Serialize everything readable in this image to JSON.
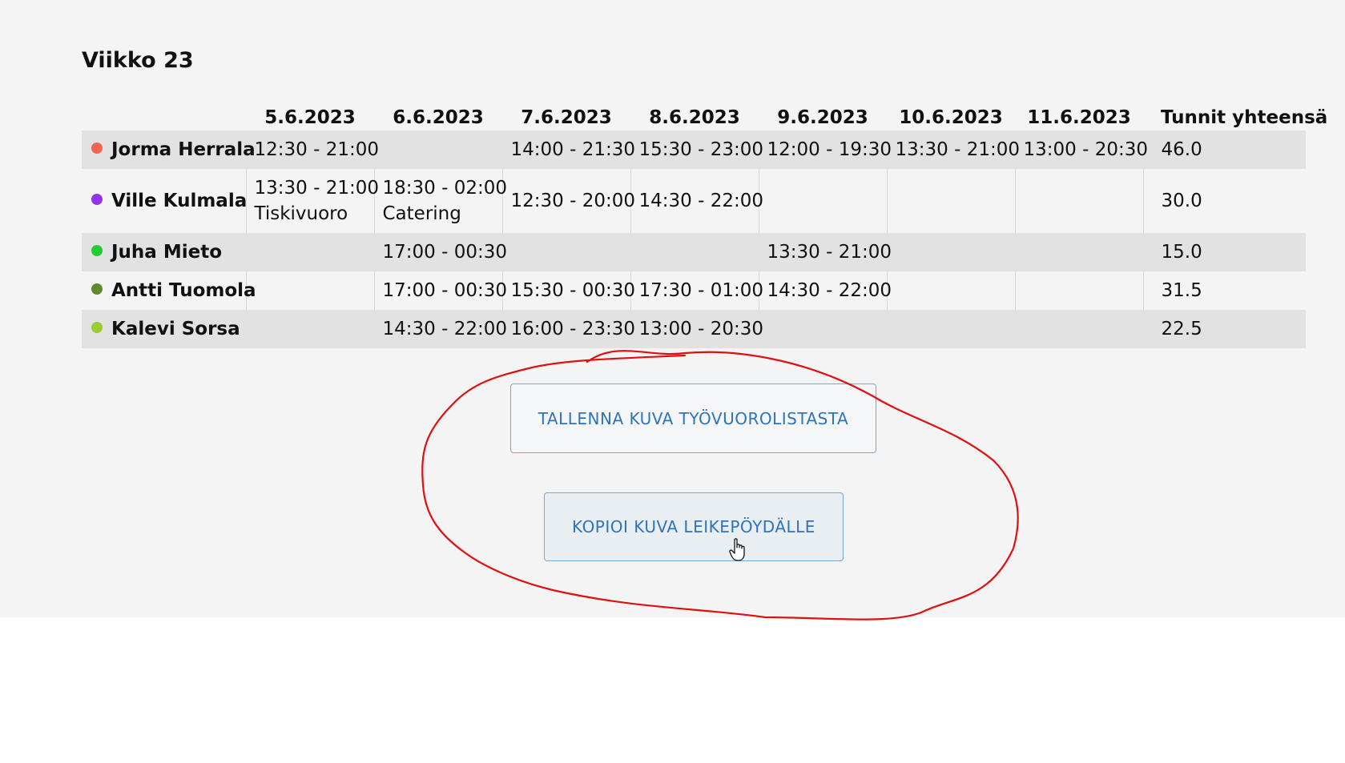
{
  "week": {
    "title": "Viikko 23"
  },
  "table": {
    "headers": [
      "",
      "5.6.2023",
      "6.6.2023",
      "7.6.2023",
      "8.6.2023",
      "9.6.2023",
      "10.6.2023",
      "11.6.2023",
      "Tunnit yhteensä"
    ],
    "rows": [
      {
        "name": "Jorma Herrala",
        "color": "#f0654f",
        "shifts": [
          {
            "time": "12:30 - 21:00",
            "note": ""
          },
          {
            "time": "",
            "note": ""
          },
          {
            "time": "14:00 - 21:30",
            "note": ""
          },
          {
            "time": "15:30 - 23:00",
            "note": ""
          },
          {
            "time": "12:00 - 19:30",
            "note": ""
          },
          {
            "time": "13:30 - 21:00",
            "note": ""
          },
          {
            "time": "13:00 - 20:30",
            "note": ""
          }
        ],
        "total": "46.0"
      },
      {
        "name": "Ville Kulmala",
        "color": "#9333ea",
        "shifts": [
          {
            "time": "13:30 - 21:00",
            "note": "Tiskivuoro"
          },
          {
            "time": "18:30 - 02:00",
            "note": "Catering"
          },
          {
            "time": "12:30 - 20:00",
            "note": ""
          },
          {
            "time": "14:30 - 22:00",
            "note": ""
          },
          {
            "time": "",
            "note": ""
          },
          {
            "time": "",
            "note": ""
          },
          {
            "time": "",
            "note": ""
          }
        ],
        "total": "30.0"
      },
      {
        "name": "Juha Mieto",
        "color": "#22cc33",
        "shifts": [
          {
            "time": "",
            "note": ""
          },
          {
            "time": "17:00 - 00:30",
            "note": ""
          },
          {
            "time": "",
            "note": ""
          },
          {
            "time": "",
            "note": ""
          },
          {
            "time": "13:30 - 21:00",
            "note": ""
          },
          {
            "time": "",
            "note": ""
          },
          {
            "time": "",
            "note": ""
          }
        ],
        "total": "15.0"
      },
      {
        "name": "Antti Tuomola",
        "color": "#5d8a2a",
        "shifts": [
          {
            "time": "",
            "note": ""
          },
          {
            "time": "17:00 - 00:30",
            "note": ""
          },
          {
            "time": "15:30 - 00:30",
            "note": ""
          },
          {
            "time": "17:30 - 01:00",
            "note": ""
          },
          {
            "time": "14:30 - 22:00",
            "note": ""
          },
          {
            "time": "",
            "note": ""
          },
          {
            "time": "",
            "note": ""
          }
        ],
        "total": "31.5"
      },
      {
        "name": "Kalevi Sorsa",
        "color": "#9acd32",
        "shifts": [
          {
            "time": "",
            "note": ""
          },
          {
            "time": "14:30 - 22:00",
            "note": ""
          },
          {
            "time": "16:00 - 23:30",
            "note": ""
          },
          {
            "time": "13:00 - 20:30",
            "note": ""
          },
          {
            "time": "",
            "note": ""
          },
          {
            "time": "",
            "note": ""
          },
          {
            "time": "",
            "note": ""
          }
        ],
        "total": "22.5"
      }
    ]
  },
  "actions": {
    "save_label": "TALLENNA KUVA TYÖVUOROLISTASTA",
    "copy_label": "KOPIOI KUVA LEIKEPÖYDÄLLE"
  },
  "annotation": {
    "color": "#e01010"
  }
}
